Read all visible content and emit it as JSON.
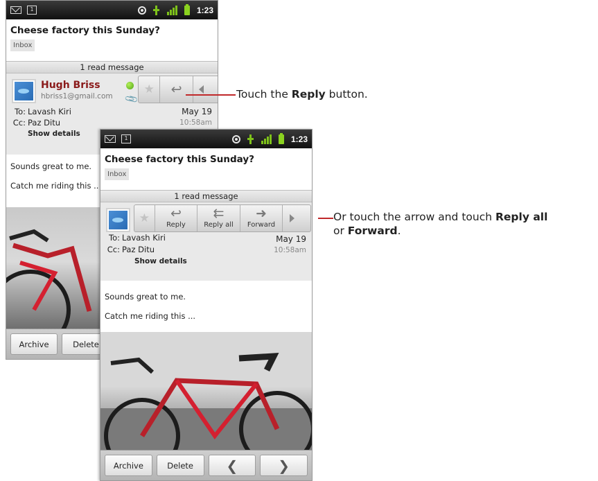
{
  "status_bar": {
    "time": "1:23",
    "cal_day": "1"
  },
  "email": {
    "subject": "Cheese factory this Sunday?",
    "label": "Inbox",
    "read_bar": "1 read message",
    "sender_name": "Hugh Briss",
    "sender_email": "hbriss1@gmail.com",
    "to_label": "To:",
    "to_value": "Lavash Kiri",
    "cc_label": "Cc:",
    "cc_value": "Paz Ditu",
    "show_details": "Show details",
    "date": "May 19",
    "time": "10:58am",
    "body_line1": "Sounds great to me.",
    "body_line2": "Catch me riding this ...",
    "body_line2_cut": "Catch me riding this .."
  },
  "actions": {
    "reply": "Reply",
    "reply_all": "Reply all",
    "forward": "Forward"
  },
  "bottom_bar": {
    "archive": "Archive",
    "delete": "Delete",
    "delete_cut": "Delete"
  },
  "callouts": {
    "reply_prefix": "Touch the ",
    "reply_bold": "Reply",
    "reply_suffix": " button.",
    "more_prefix": "Or touch the arrow and touch ",
    "more_bold1": "Reply all",
    "more_mid": "or ",
    "more_bold2": "Forward",
    "more_suffix": "."
  },
  "colors": {
    "sender_name": "#8a1a1a",
    "callout_line": "#c0282a",
    "signal_green": "#7ec21a"
  }
}
